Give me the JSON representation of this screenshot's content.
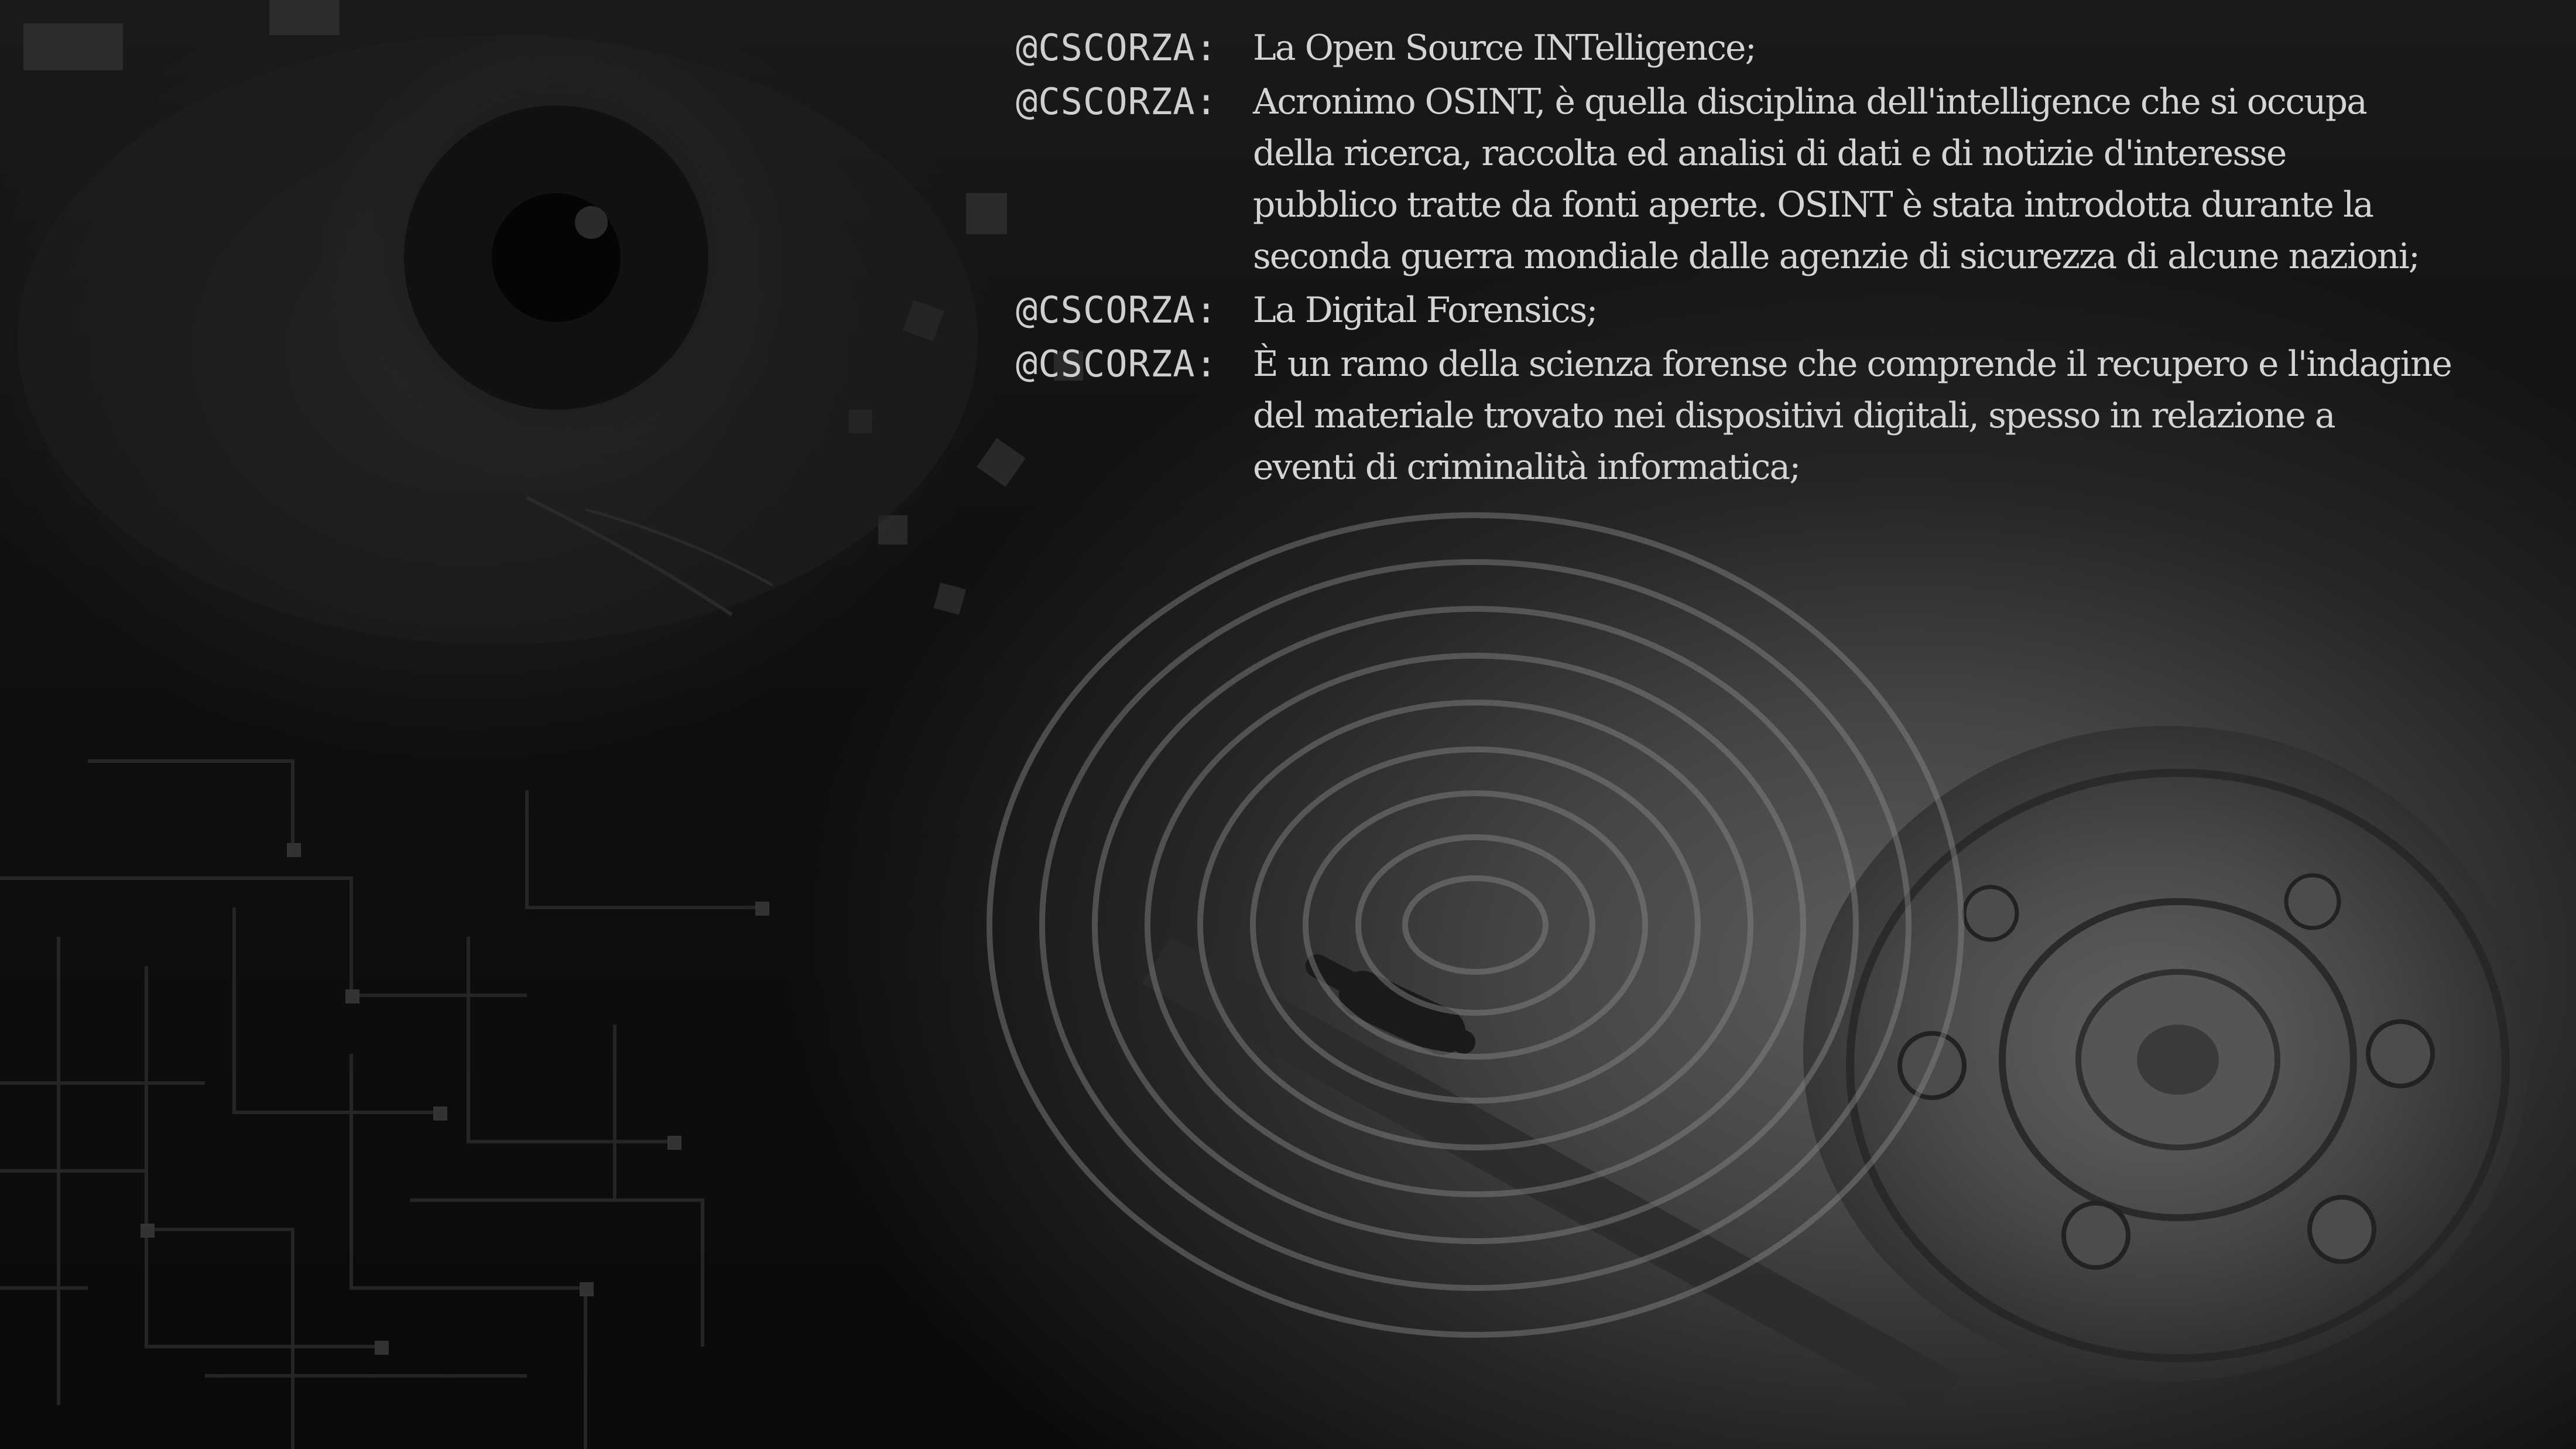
{
  "terminal": {
    "entries": [
      {
        "prompt": "@CSCORZA:",
        "message": "La Open Source INTelligence;"
      },
      {
        "prompt": "@CSCORZA:",
        "message": "Acronimo OSINT, è quella disciplina dell'intelligence che si occupa\ndella ricerca, raccolta ed analisi di dati e di notizie d'interesse\npubblico tratte da fonti aperte. OSINT è stata introdotta durante la\nseconda guerra mondiale dalle agenzie di sicurezza di alcune nazioni;"
      },
      {
        "prompt": "@CSCORZA:",
        "message": "La Digital Forensics;"
      },
      {
        "prompt": "@CSCORZA:",
        "message": "È un ramo della scienza forense che comprende il recupero e l'indagine\ndel materiale trovato nei dispositivi digitali, spesso in relazione a\neventi di criminalità informatica;"
      }
    ]
  },
  "background": {
    "motifs": [
      "eye-icon",
      "fingerprint-icon",
      "hard-drive-icon",
      "circuit-board-pattern"
    ],
    "colors": {
      "base": "#0b0b0b",
      "highlight": "#5d5d5d",
      "text": "#d4d4d4"
    }
  }
}
